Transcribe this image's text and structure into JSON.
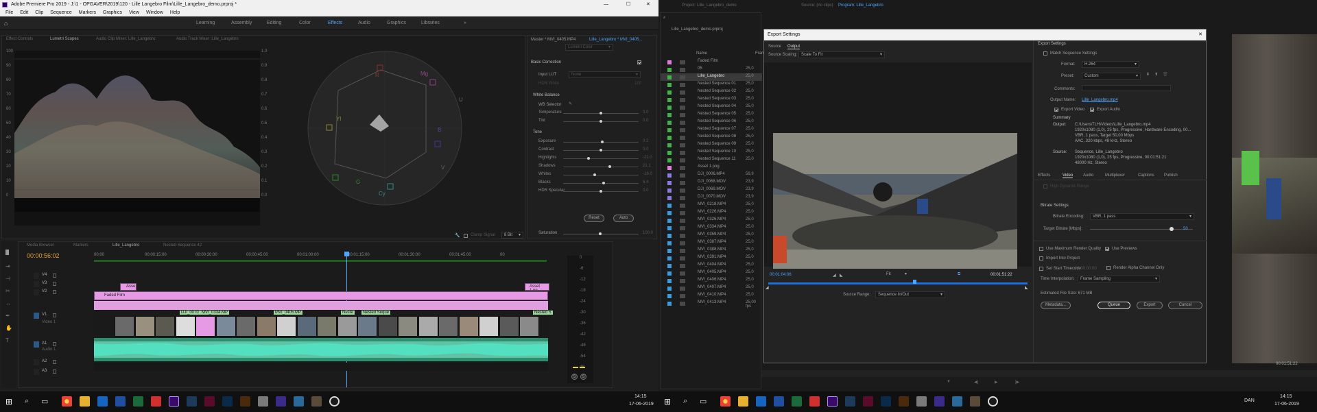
{
  "left": {
    "app_title": "Adobe Premiere Pro 2019 - J:\\1 - OPGAVER\\2019\\120 - Lille Langebro Film\\Lille_Langebro_demo.prproj *",
    "window_controls": {
      "min": "—",
      "max": "☐",
      "close": "✕"
    },
    "menu": [
      "File",
      "Edit",
      "Clip",
      "Sequence",
      "Markers",
      "Graphics",
      "View",
      "Window",
      "Help"
    ],
    "workspaces": [
      "Learning",
      "Assembly",
      "Editing",
      "Color",
      "Effects",
      "Audio",
      "Graphics",
      "Libraries"
    ],
    "workspace_more": "»",
    "active_workspace": "Effects",
    "scope_tabs": [
      "Effect Controls",
      "Lumetri Scopes",
      "Audio Clip Mixer: Lille_Langebro",
      "Audio Track Mixer: Lille_Langebro"
    ],
    "waveform_left_ticks": [
      "100",
      "90",
      "80",
      "70",
      "60",
      "50",
      "40",
      "30",
      "20",
      "10",
      "0"
    ],
    "waveform_right_ticks": [
      "1.0",
      "0.9",
      "0.8",
      "0.7",
      "0.6",
      "0.5",
      "0.4",
      "0.3",
      "0.2",
      "0.1",
      "0.0"
    ],
    "vectorscope_labels": [
      "R",
      "Mg",
      "B",
      "Cy",
      "G",
      "Yl",
      "U",
      "V"
    ],
    "clamp_signal": "Clamp Signal",
    "scope_dropdown": "8 Bit",
    "lumetri": {
      "header_master": "Master * MVI_0405.MP4",
      "header_seq": "Lille_Langebro * MVI_0405...",
      "preset": "Lumetri Color",
      "section": "Basic Correction",
      "input_lut_label": "Input LUT",
      "input_lut_value": "None",
      "hdr_white": "HDR White",
      "hdr_white_val": "100",
      "white_balance": "White Balance",
      "wb_selector": "WB Selector",
      "tone": "Tone",
      "rows_wb": [
        {
          "label": "Temperature",
          "value": "0.0",
          "pos": 0.5
        },
        {
          "label": "Tint",
          "value": "0.0",
          "pos": 0.5
        }
      ],
      "rows_tone": [
        {
          "label": "Exposure",
          "value": "0.2",
          "pos": 0.52
        },
        {
          "label": "Contrast",
          "value": "0.0",
          "pos": 0.5
        },
        {
          "label": "Highlights",
          "value": "-22.0",
          "pos": 0.34
        },
        {
          "label": "Shadows",
          "value": "21.1",
          "pos": 0.62
        },
        {
          "label": "Whites",
          "value": "-16.0",
          "pos": 0.42
        },
        {
          "label": "Blacks",
          "value": "6.4",
          "pos": 0.54
        },
        {
          "label": "HDR Specular",
          "value": "0.0",
          "pos": 0.5
        }
      ],
      "reset": "Reset",
      "auto": "Auto",
      "saturation_label": "Saturation",
      "saturation_value": "100.0"
    },
    "timeline": {
      "tabs": [
        "Media Browser",
        "Markers",
        "Lille_Langebro",
        "Nested Sequence 42"
      ],
      "timecode": "00:00:56:02",
      "ruler": [
        "00:00",
        "00:00:15:00",
        "00:00:30:00",
        "00:00:45:00",
        "00:01:00:00",
        "00:01:15:00",
        "00:01:30:00",
        "00:01:45:00",
        "00"
      ],
      "tracks": [
        "V4",
        "V3",
        "V2",
        "V1",
        "A1",
        "A2",
        "A3"
      ],
      "v1_name": "Video 1",
      "a1_name": "Audio 1",
      "clip_asset": "Asse",
      "clip_asset_end": "Asset 1.pn",
      "clip_faded": "Faded Film",
      "v1_clips": [
        "DJI_0070",
        "MVI_0334.MP",
        "MVI_0405.MP",
        "Neste",
        "Nested Seque",
        "Nested S"
      ],
      "meter_ticks": [
        "0",
        "-6",
        "-12",
        "-18",
        "-24",
        "-30",
        "-36",
        "-42",
        "-48",
        "-54",
        "dB"
      ],
      "meter_buttons": [
        "S",
        "S"
      ]
    },
    "taskbar_time": "14:15",
    "taskbar_date": "17-06-2019"
  },
  "right": {
    "top_tabs": [
      "Project: Lille_Langebro_demo",
      "Source: (no clips)",
      "Program: Lille_Langebro"
    ],
    "project_file": "Lille_Langebro_demo.prproj",
    "col_name": "Name",
    "col_fr": "Fram",
    "items": [
      {
        "name": "Faded Film",
        "fr": "",
        "color": "#e07be0"
      },
      {
        "name": "05",
        "fr": "25,0",
        "color": "#3fb34a"
      },
      {
        "name": "Lille_Langebro",
        "fr": "25,0",
        "color": "#3fb34a"
      },
      {
        "name": "Nested Sequence 01",
        "fr": "25,0",
        "color": "#3fb34a"
      },
      {
        "name": "Nested Sequence 02",
        "fr": "25,0",
        "color": "#3fb34a"
      },
      {
        "name": "Nested Sequence 03",
        "fr": "25,0",
        "color": "#3fb34a"
      },
      {
        "name": "Nested Sequence 04",
        "fr": "25,0",
        "color": "#3fb34a"
      },
      {
        "name": "Nested Sequence 05",
        "fr": "25,0",
        "color": "#3fb34a"
      },
      {
        "name": "Nested Sequence 06",
        "fr": "25,0",
        "color": "#3fb34a"
      },
      {
        "name": "Nested Sequence 07",
        "fr": "25,0",
        "color": "#3fb34a"
      },
      {
        "name": "Nested Sequence 08",
        "fr": "25,0",
        "color": "#3fb34a"
      },
      {
        "name": "Nested Sequence 09",
        "fr": "25,0",
        "color": "#3fb34a"
      },
      {
        "name": "Nested Sequence 10",
        "fr": "25,0",
        "color": "#3fb34a"
      },
      {
        "name": "Nested Sequence 11",
        "fr": "25,0",
        "color": "#3fb34a"
      },
      {
        "name": "Asset 1.png",
        "fr": "",
        "color": "#e07be0"
      },
      {
        "name": "DJI_0006.MP4",
        "fr": "59,9",
        "color": "#8a7ae0"
      },
      {
        "name": "DJI_0068.MOV",
        "fr": "23,9",
        "color": "#8a7ae0"
      },
      {
        "name": "DJI_0069.MOV",
        "fr": "23,9",
        "color": "#8a7ae0"
      },
      {
        "name": "DJI_0070.MOV",
        "fr": "23,9",
        "color": "#8a7ae0"
      },
      {
        "name": "MVI_0218.MP4",
        "fr": "25,0",
        "color": "#3b9be0"
      },
      {
        "name": "MVI_0226.MP4",
        "fr": "25,0",
        "color": "#3b9be0"
      },
      {
        "name": "MVI_0326.MP4",
        "fr": "25,0",
        "color": "#3b9be0"
      },
      {
        "name": "MVI_0334.MP4",
        "fr": "25,0",
        "color": "#3b9be0"
      },
      {
        "name": "MVI_0359.MP4",
        "fr": "25,0",
        "color": "#3b9be0"
      },
      {
        "name": "MVI_0387.MP4",
        "fr": "25,0",
        "color": "#3b9be0"
      },
      {
        "name": "MVI_0388.MP4",
        "fr": "25,0",
        "color": "#3b9be0"
      },
      {
        "name": "MVI_0391.MP4",
        "fr": "25,0",
        "color": "#3b9be0"
      },
      {
        "name": "MVI_0404.MP4",
        "fr": "25,0",
        "color": "#3b9be0"
      },
      {
        "name": "MVI_0405.MP4",
        "fr": "25,0",
        "color": "#3b9be0"
      },
      {
        "name": "MVI_0406.MP4",
        "fr": "25,0",
        "color": "#3b9be0"
      },
      {
        "name": "MVI_0407.MP4",
        "fr": "25,0",
        "color": "#3b9be0"
      },
      {
        "name": "MVI_0410.MP4",
        "fr": "25,0",
        "color": "#3b9be0"
      },
      {
        "name": "MVI_0413.MP4",
        "fr": "25,00 fps",
        "color": "#3b9be0"
      }
    ],
    "export": {
      "title": "Export Settings",
      "close": "✕",
      "tabs": [
        "Source",
        "Output"
      ],
      "source_scaling_label": "Source Scaling:",
      "source_scaling_value": "Scale To Fit",
      "tc_in": "00:01:04:06",
      "tc_out": "00:01:51:22",
      "fit": "Fit",
      "source_range_label": "Source Range:",
      "source_range_value": "Sequence In/Out",
      "section": "Export Settings",
      "match_seq": "Match Sequence Settings",
      "format_label": "Format:",
      "format_value": "H.264",
      "preset_label": "Preset:",
      "preset_value": "Custom",
      "comments_label": "Comments:",
      "output_name_label": "Output Name:",
      "output_name_value": "Lille_Langebro.mp4",
      "export_video": "Export Video",
      "export_audio": "Export Audio",
      "summary": "Summary",
      "output_label": "Output:",
      "output_lines": [
        "C:\\Users\\TLH\\Videos\\Lille_Langebro.mp4",
        "1920x1080 (1,0), 25 fps, Progressive, Hardware Encoding, 00...",
        "VBR, 1 pass, Target 50,00 Mbps",
        "AAC, 320 kbps, 48 kHz, Stereo"
      ],
      "source_label": "Source:",
      "source_lines": [
        "Sequence, Lille_Langebro",
        "1920x1080 (1,0), 25 fps, Progressive, 00:01:51:21",
        "48000 Hz, Stereo"
      ],
      "settings_tabs": [
        "Effects",
        "Video",
        "Audio",
        "Multiplexer",
        "Captions",
        "Publish"
      ],
      "hdr_graded": "High Dynamic Range",
      "bitrate_section": "Bitrate Settings",
      "bitrate_encoding_label": "Bitrate Encoding:",
      "bitrate_encoding_value": "VBR, 1 pass",
      "target_bitrate_label": "Target Bitrate [Mbps]:",
      "target_bitrate_value": "50",
      "use_max_render": "Use Maximum Render Quality",
      "use_previews": "Use Previews",
      "import_into_project": "Import Into Project",
      "set_start_tc": "Set Start Timecode",
      "start_tc": "00:00:00:00",
      "render_alpha": "Render Alpha Channel Only",
      "time_interp_label": "Time Interpolation:",
      "time_interp_value": "Frame Sampling",
      "est_size": "Estimated File Size: 671 MB",
      "metadata": "Metadata...",
      "queue": "Queue",
      "export": "Export",
      "cancel": "Cancel"
    },
    "program_timecode": "00:01:51:22",
    "program_fit": "1/4",
    "proj_footer_zoom": "",
    "taskbar_lang": "DAN",
    "taskbar_time": "14:15",
    "taskbar_date": "17-06-2019"
  }
}
